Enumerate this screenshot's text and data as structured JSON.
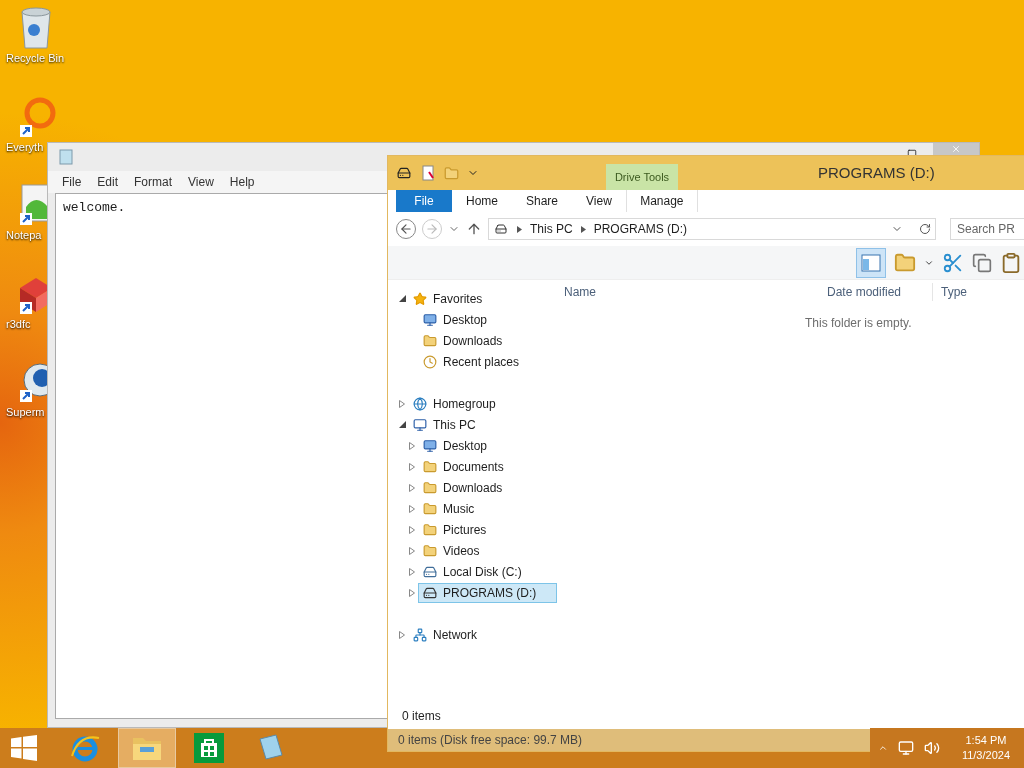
{
  "desktop_icons": [
    {
      "label": "Recycle Bin",
      "kind": "bin"
    },
    {
      "label": "Everyth",
      "kind": "search"
    },
    {
      "label": "Notepa",
      "kind": "notepad"
    },
    {
      "label": "r3dfc",
      "kind": "box"
    },
    {
      "label": "Superm",
      "kind": "globe"
    }
  ],
  "notepad": {
    "menu": [
      "File",
      "Edit",
      "Format",
      "View",
      "Help"
    ],
    "text": "welcome."
  },
  "explorer": {
    "title": "PROGRAMS (D:)",
    "contextual_tab": "Drive Tools",
    "ribbon_tabs": [
      {
        "label": "File",
        "kind": "file",
        "selected": false
      },
      {
        "label": "Home",
        "kind": "tab",
        "selected": false
      },
      {
        "label": "Share",
        "kind": "tab",
        "selected": false
      },
      {
        "label": "View",
        "kind": "tab",
        "selected": false
      },
      {
        "label": "Manage",
        "kind": "contextual",
        "selected": false
      }
    ],
    "breadcrumbs": [
      "This PC",
      "PROGRAMS (D:)"
    ],
    "search": {
      "placeholder": "Search PR"
    },
    "columns": [
      "Name",
      "Date modified",
      "Type"
    ],
    "empty_message": "This folder is empty.",
    "nav": [
      {
        "label": "Favorites",
        "kind": "star",
        "expanded": true,
        "selected": false,
        "children": [
          {
            "label": "Desktop",
            "kind": "desktop",
            "selected": false
          },
          {
            "label": "Downloads",
            "kind": "downloads",
            "selected": false
          },
          {
            "label": "Recent places",
            "kind": "recent",
            "selected": false
          }
        ]
      },
      {
        "label": "Homegroup",
        "kind": "homegroup",
        "expanded": false,
        "selected": false
      },
      {
        "label": "This PC",
        "kind": "pc",
        "expanded": true,
        "selected": false,
        "children": [
          {
            "label": "Desktop",
            "kind": "desktop",
            "expanded": false,
            "selected": false
          },
          {
            "label": "Documents",
            "kind": "folder",
            "expanded": false,
            "selected": false
          },
          {
            "label": "Downloads",
            "kind": "downloads",
            "expanded": false,
            "selected": false
          },
          {
            "label": "Music",
            "kind": "folder",
            "expanded": false,
            "selected": false
          },
          {
            "label": "Pictures",
            "kind": "folder",
            "expanded": false,
            "selected": false
          },
          {
            "label": "Videos",
            "kind": "folder",
            "expanded": false,
            "selected": false
          },
          {
            "label": "Local Disk (C:)",
            "kind": "windrive",
            "expanded": false,
            "selected": false
          },
          {
            "label": "PROGRAMS (D:)",
            "kind": "drive",
            "expanded": false,
            "selected": true
          }
        ]
      },
      {
        "label": "Network",
        "kind": "network",
        "expanded": false,
        "selected": false
      }
    ],
    "item_count": "0 items",
    "status": "0 items (Disk free space: 99.7 MB)"
  },
  "taskbar": {
    "apps": [
      {
        "kind": "ie",
        "active": false
      },
      {
        "kind": "explorer",
        "active": true
      },
      {
        "kind": "store",
        "active": false
      },
      {
        "kind": "notepad",
        "active": false
      }
    ],
    "time": "1:54 PM",
    "date": "11/3/2024"
  }
}
